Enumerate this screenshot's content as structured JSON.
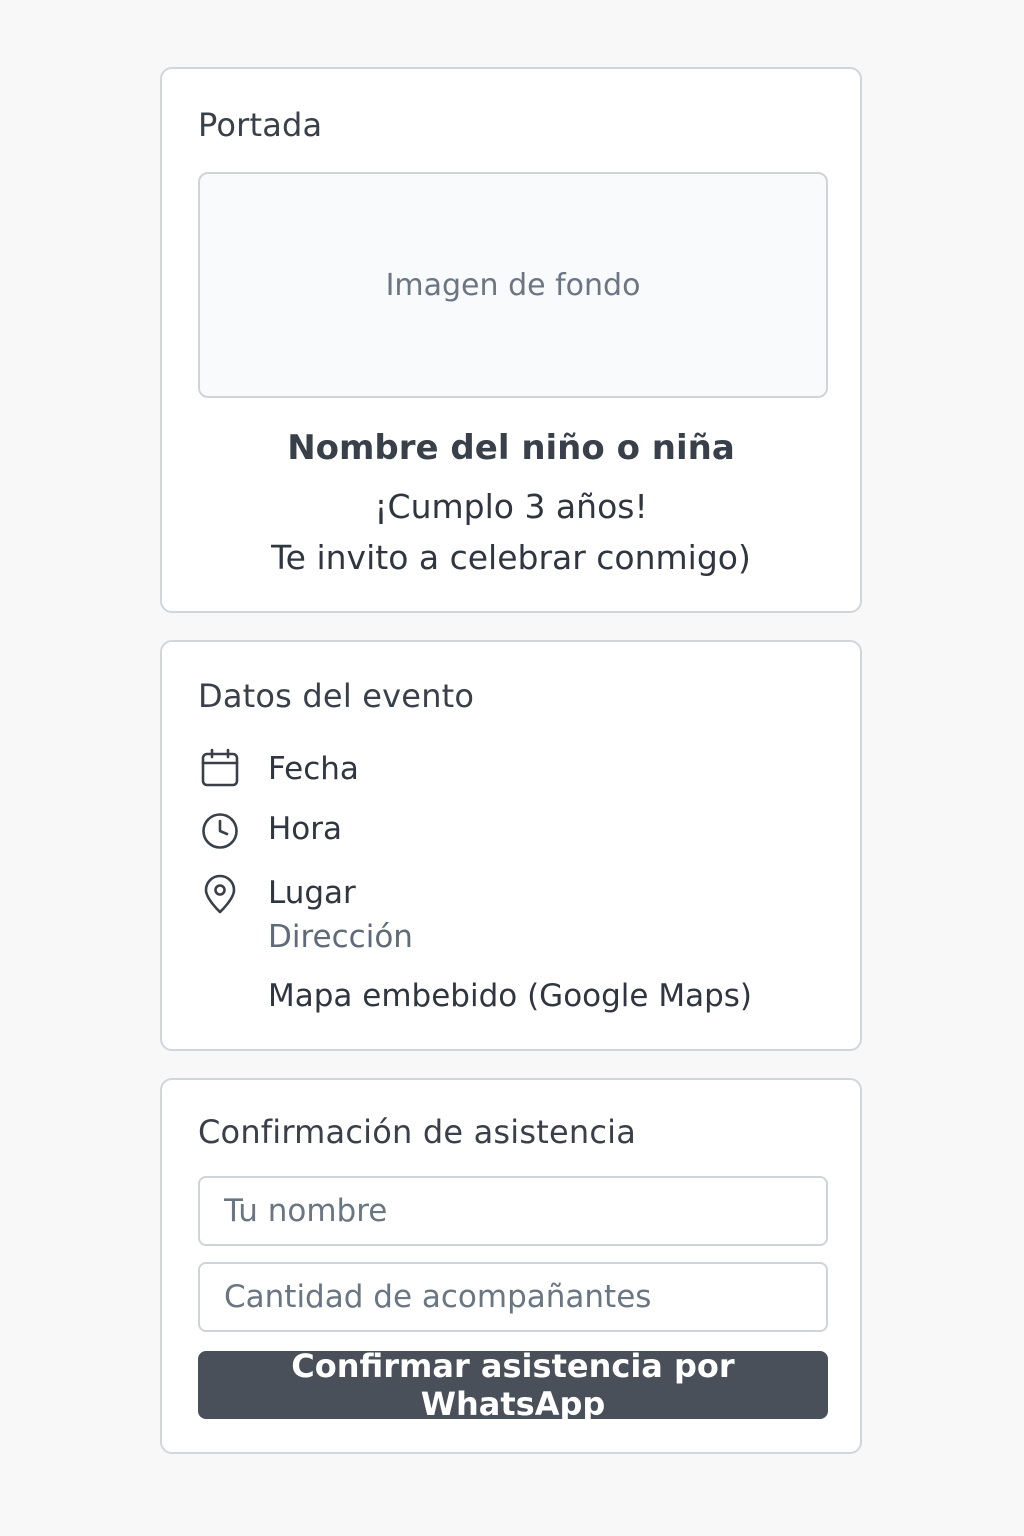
{
  "colors": {
    "page_background": "#f8f8f9",
    "card_border": "#d2d6da",
    "text_primary": "#2f3640",
    "text_muted": "#6b7683",
    "button_background": "#4a5059",
    "button_text": "#ffffff"
  },
  "portada": {
    "title": "Portada",
    "image_placeholder": "Imagen de fondo",
    "child_name": "Nombre del niño o niña",
    "line_1": "¡Cumplo 3 años!",
    "line_2": "Te invito a celebrar conmigo)"
  },
  "evento": {
    "title": "Datos del evento",
    "items": [
      {
        "icon": "calendar-icon",
        "label": "Fecha"
      },
      {
        "icon": "clock-icon",
        "label": "Hora"
      },
      {
        "icon": "location-pin-icon",
        "label": "Lugar"
      }
    ],
    "address": "Dirección",
    "map": "Mapa embebido (Google Maps)"
  },
  "confirmacion": {
    "title": "Confirmación de asistencia",
    "name_placeholder": "Tu nombre",
    "name_value": "",
    "companions_placeholder": "Cantidad de acompañantes",
    "companions_value": "",
    "button_label": "Confirmar asistencia por WhatsApp"
  }
}
